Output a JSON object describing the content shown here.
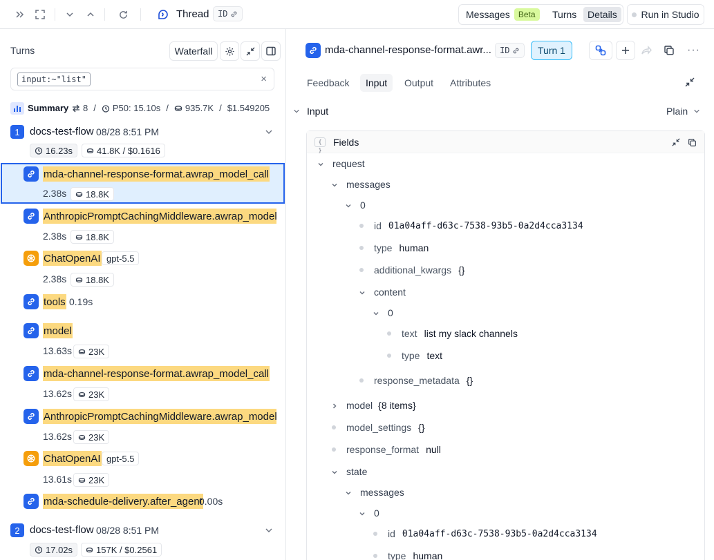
{
  "topbar": {
    "title": "Thread",
    "id_label": "ID",
    "segments": [
      "Messages",
      "Beta",
      "Turns",
      "Details"
    ],
    "run_in_studio": "Run in Studio"
  },
  "left": {
    "heading": "Turns",
    "waterfall": "Waterfall",
    "filter": "input:~\"list\"",
    "summary": {
      "label": "Summary",
      "turns": "8",
      "p50": "P50: 15.10s",
      "tokens": "935.7K",
      "cost": "$1.549205"
    },
    "flows": [
      {
        "num": "1",
        "name": "docs-test-flow",
        "date": "08/28 8:51 PM",
        "time": "16.23s",
        "tokens": "41.8K / $0.1616"
      },
      {
        "num": "2",
        "name": "docs-test-flow",
        "date": "08/28 8:51 PM",
        "time": "17.02s",
        "tokens": "157K / $0.2561"
      }
    ],
    "runs": [
      {
        "name": "mda-channel-response-format.awrap_model_call",
        "time": "2.38s",
        "tokens": "18.8K"
      },
      {
        "name": "AnthropicPromptCachingMiddleware.awrap_model_call",
        "time": "2.38s",
        "tokens": "18.8K"
      },
      {
        "name": "ChatOpenAI",
        "model": "gpt-5.5",
        "time": "2.38s",
        "tokens": "18.8K"
      },
      {
        "name": "tools",
        "time": "0.19s"
      },
      {
        "name": "model",
        "time": "13.63s",
        "tokens": "23K"
      },
      {
        "name": "mda-channel-response-format.awrap_model_call",
        "time": "13.62s",
        "tokens": "23K"
      },
      {
        "name": "AnthropicPromptCachingMiddleware.awrap_model_call",
        "time": "13.62s",
        "tokens": "23K"
      },
      {
        "name": "ChatOpenAI",
        "model": "gpt-5.5",
        "time": "13.61s",
        "tokens": "23K"
      },
      {
        "name": "mda-schedule-delivery.after_agent",
        "time": "0.00s"
      }
    ]
  },
  "right": {
    "run_title": "mda-channel-response-format.awr...",
    "id_label": "ID",
    "turn_button": "Turn 1",
    "tabs": [
      "Feedback",
      "Input",
      "Output",
      "Attributes"
    ],
    "section": "Input",
    "view_mode": "Plain",
    "fields_label": "Fields",
    "tree": [
      {
        "key": "request"
      },
      {
        "key": "messages"
      },
      {
        "key": "0"
      },
      {
        "key": "id",
        "value": "01a04aff-d63c-7538-93b5-0a2d4cca3134"
      },
      {
        "key": "type",
        "value": "human"
      },
      {
        "key": "additional_kwargs",
        "value": "{}"
      },
      {
        "key": "content"
      },
      {
        "key": "0"
      },
      {
        "key": "text",
        "value": "list my slack channels"
      },
      {
        "key": "type",
        "value": "text"
      },
      {
        "key": "response_metadata",
        "value": "{}"
      },
      {
        "key": "model",
        "value": "{8 items}"
      },
      {
        "key": "model_settings",
        "value": "{}"
      },
      {
        "key": "response_format",
        "value": "null"
      },
      {
        "key": "state"
      },
      {
        "key": "messages"
      },
      {
        "key": "0"
      },
      {
        "key": "id",
        "value": "01a04aff-d63c-7538-93b5-0a2d4cca3134"
      },
      {
        "key": "type",
        "value": "human"
      }
    ]
  }
}
